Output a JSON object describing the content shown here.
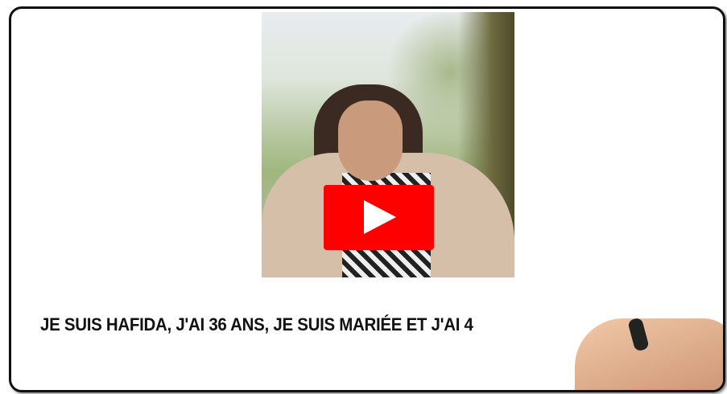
{
  "video": {
    "caption": "JE  SUIS HAFIDA, J'AI 36 ANS, JE SUIS  MARIÉE ET J'AI 4",
    "play_button_color": "#ff0000",
    "play_icon": "play-icon"
  }
}
